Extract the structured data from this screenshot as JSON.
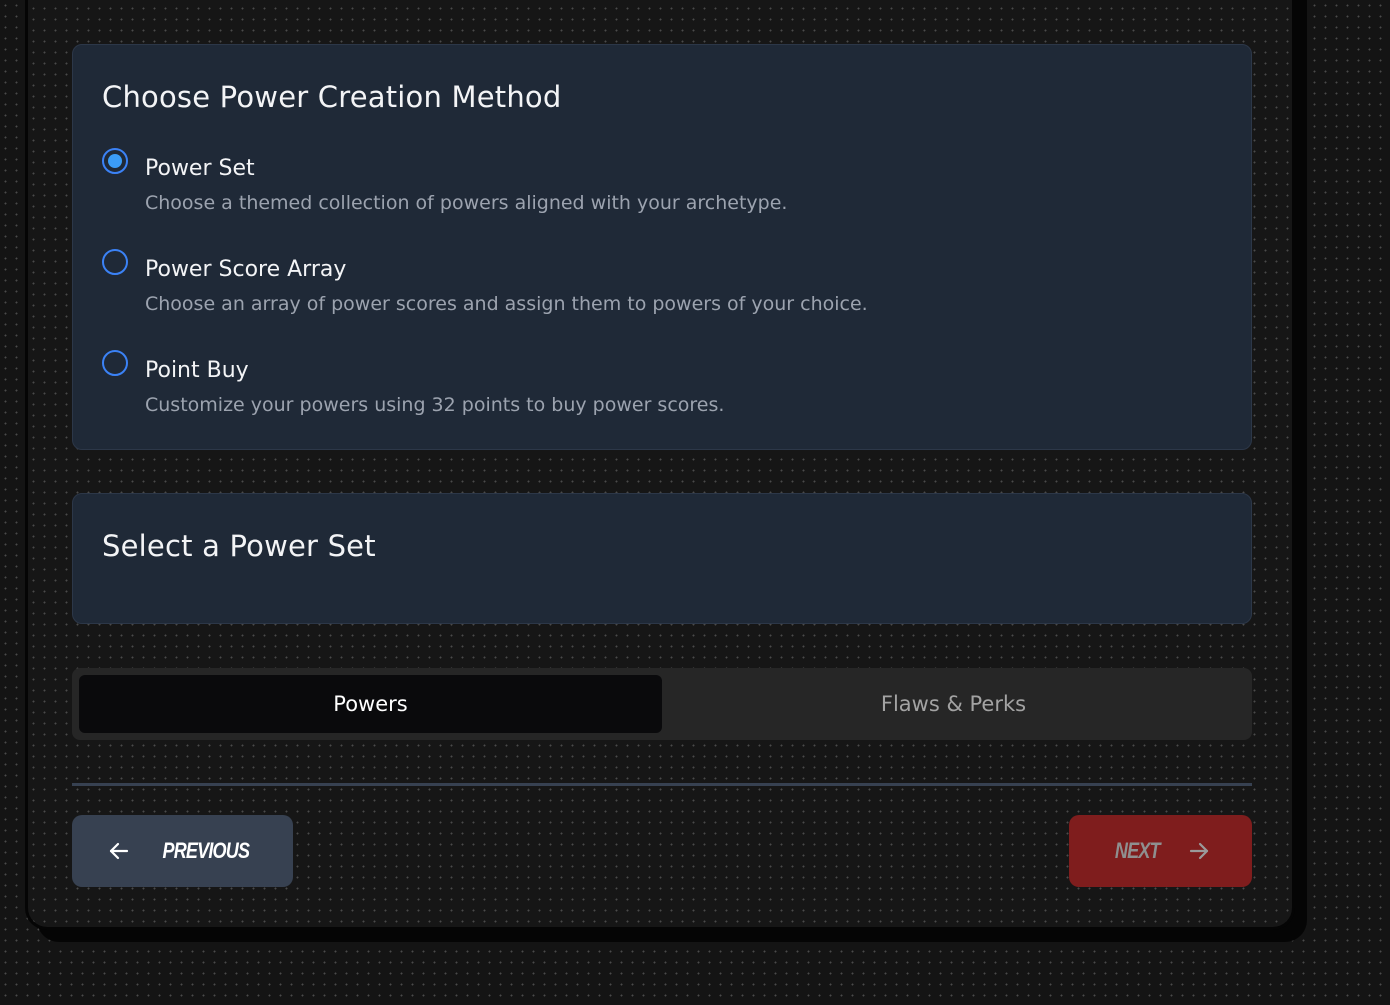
{
  "method_card": {
    "title": "Choose Power Creation Method",
    "options": [
      {
        "label": "Power Set",
        "description": "Choose a themed collection of powers aligned with your archetype.",
        "selected": true
      },
      {
        "label": "Power Score Array",
        "description": "Choose an array of power scores and assign them to powers of your choice.",
        "selected": false
      },
      {
        "label": "Point Buy",
        "description": "Customize your powers using 32 points to buy power scores.",
        "selected": false
      }
    ]
  },
  "power_set_card": {
    "title": "Select a Power Set"
  },
  "tabs": [
    {
      "label": "Powers",
      "active": true
    },
    {
      "label": "Flaws & Perks",
      "active": false
    }
  ],
  "navigation": {
    "previous_label": "PREVIOUS",
    "next_label": "NEXT"
  },
  "colors": {
    "accent": "#3b82f6",
    "card_bg": "#1f2937",
    "next_button": "#7f1d1d",
    "previous_button": "#374151"
  },
  "icons": {
    "previous": "arrow-left-icon",
    "next": "arrow-right-icon"
  }
}
